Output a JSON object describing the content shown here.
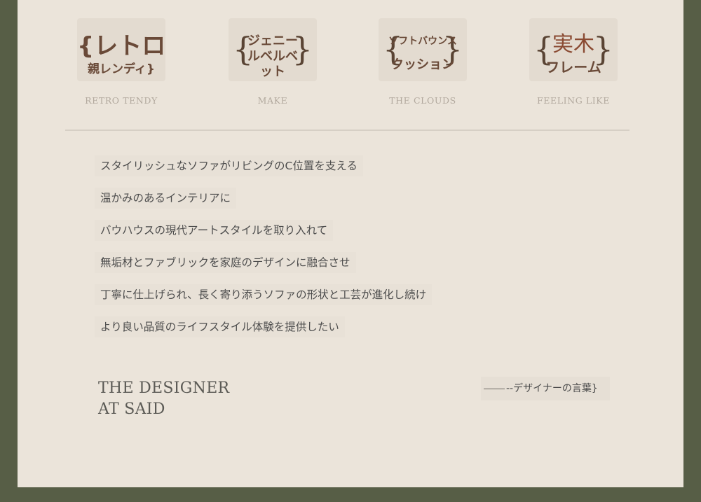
{
  "features": [
    {
      "badge_lines": [
        "{レトロ",
        "親レンディ}"
      ],
      "label": "RETRO TENDY",
      "icon": "retro-tendy-badge-icon"
    },
    {
      "badge_lines": [
        "ジェニー",
        "ルベルベ",
        "ット"
      ],
      "label": "MAKE",
      "icon": "make-badge-icon"
    },
    {
      "badge_lines": [
        "ソフトバウンス",
        "クッション"
      ],
      "label": "THE CLOUDS",
      "icon": "clouds-badge-icon"
    },
    {
      "badge_lines": [
        "実木",
        "フレーム"
      ],
      "label": "FEELING LIKE",
      "icon": "feeling-badge-icon"
    }
  ],
  "description": [
    "スタイリッシュなソファがリビングのC位置を支える",
    "温かみのあるインテリアに",
    "バウハウスの現代アートスタイルを取り入れて",
    "無垢材とファブリックを家庭のデザインに融合させ",
    "丁寧に仕上げられ、長く寄り添うソファの形状と工芸が進化し続け",
    "より良い品質のライフスタイル体験を提供したい"
  ],
  "designer": {
    "line1": "THE DESIGNER",
    "line2": "AT SAID"
  },
  "signature": "--デザイナーの言葉}",
  "colors": {
    "frame": "#575e46",
    "panel": "#ebe4da",
    "badge_text": "#6a4a38",
    "label": "#b2a99e"
  }
}
